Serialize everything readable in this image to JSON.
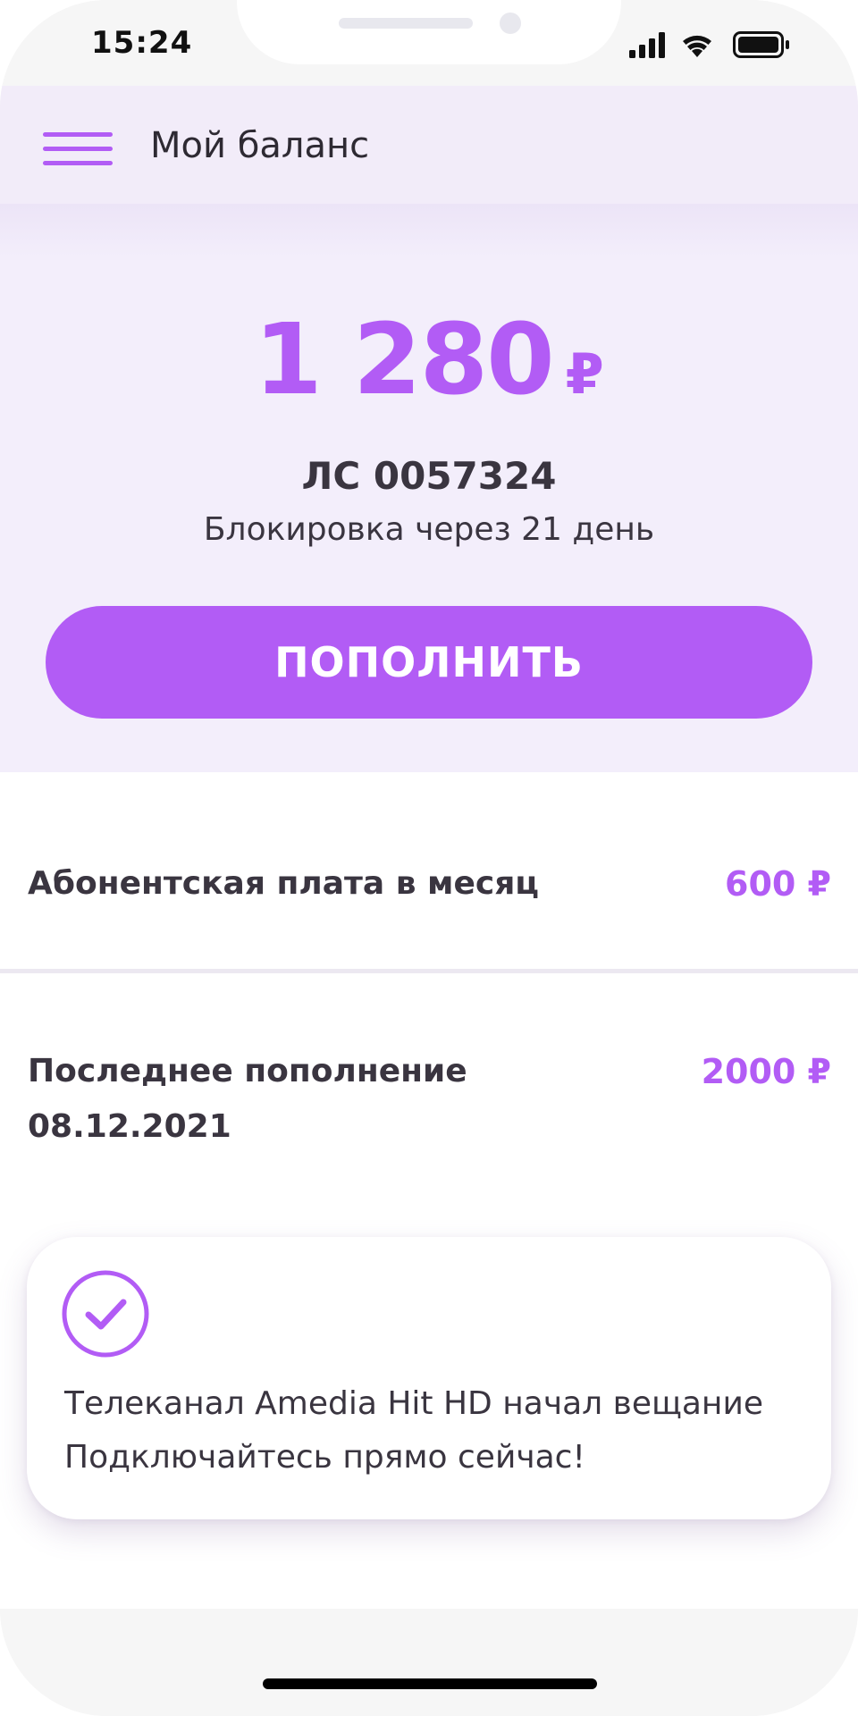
{
  "status_bar": {
    "time": "15:24",
    "icons": [
      "signal-icon",
      "wifi-icon",
      "battery-icon"
    ]
  },
  "header": {
    "menu_icon": "hamburger-menu-icon",
    "title": "Мой баланс"
  },
  "balance": {
    "amount": "1 280",
    "currency": "₽",
    "account": "ЛС 0057324",
    "block_notice": "Блокировка через 21 день",
    "topup_label": "ПОПОЛНИТЬ"
  },
  "rows": [
    {
      "label": "Абонентская плата в месяц",
      "value": "600 ₽"
    },
    {
      "label": "Последнее пополнение",
      "date": "08.12.2021",
      "value": "2000 ₽"
    }
  ],
  "notice": {
    "icon": "check-circle-icon",
    "line1": "Телеканал Amedia Hit HD начал вещание",
    "line2": "Подключайтесь прямо сейчас!"
  },
  "colors": {
    "accent": "#b25cf5",
    "panel_bg": "#f3eefb",
    "text": "#3a3540"
  }
}
